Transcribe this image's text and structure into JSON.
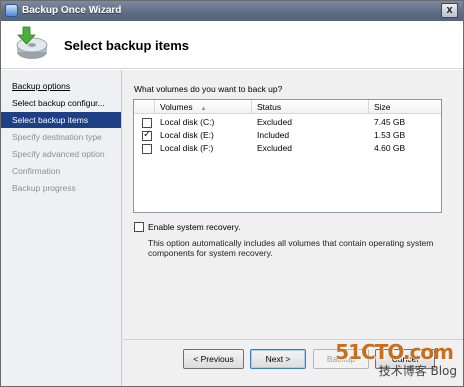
{
  "window": {
    "title": "Backup Once Wizard",
    "close_label": "x"
  },
  "header": {
    "page_title": "Select backup items"
  },
  "nav": {
    "items": [
      {
        "label": "Backup options",
        "state": "link"
      },
      {
        "label": "Select backup configur...",
        "state": "normal"
      },
      {
        "label": "Select backup items",
        "state": "active"
      },
      {
        "label": "Specify destination type",
        "state": "disabled"
      },
      {
        "label": "Specify advanced option",
        "state": "disabled"
      },
      {
        "label": "Confirmation",
        "state": "disabled"
      },
      {
        "label": "Backup progress",
        "state": "disabled"
      }
    ]
  },
  "content": {
    "question": "What volumes do you want to back up?",
    "table": {
      "columns": [
        "Volumes",
        "Status",
        "Size"
      ],
      "rows": [
        {
          "checked": false,
          "volume": "Local disk (C:)",
          "status": "Excluded",
          "size": "7.45 GB"
        },
        {
          "checked": true,
          "volume": "Local disk (E:)",
          "status": "Included",
          "size": "1.53 GB"
        },
        {
          "checked": false,
          "volume": "Local disk (F:)",
          "status": "Excluded",
          "size": "4.60 GB"
        }
      ]
    },
    "recovery": {
      "checked": false,
      "label": "Enable system recovery.",
      "description": "This option automatically includes all volumes that contain operating system components for system recovery."
    }
  },
  "footer": {
    "previous": "< Previous",
    "next": "Next >",
    "backup": "Backup",
    "cancel": "Cancel"
  },
  "watermark": {
    "line1": "51CTO.com",
    "line2": "技术博客 Blog"
  },
  "colors": {
    "title_bar": "#5d6b83",
    "nav_active": "#1c3f86",
    "nav_background": "#eef0f4",
    "content_background": "#f0f0f0",
    "watermark_orange": "#c86e1e"
  }
}
